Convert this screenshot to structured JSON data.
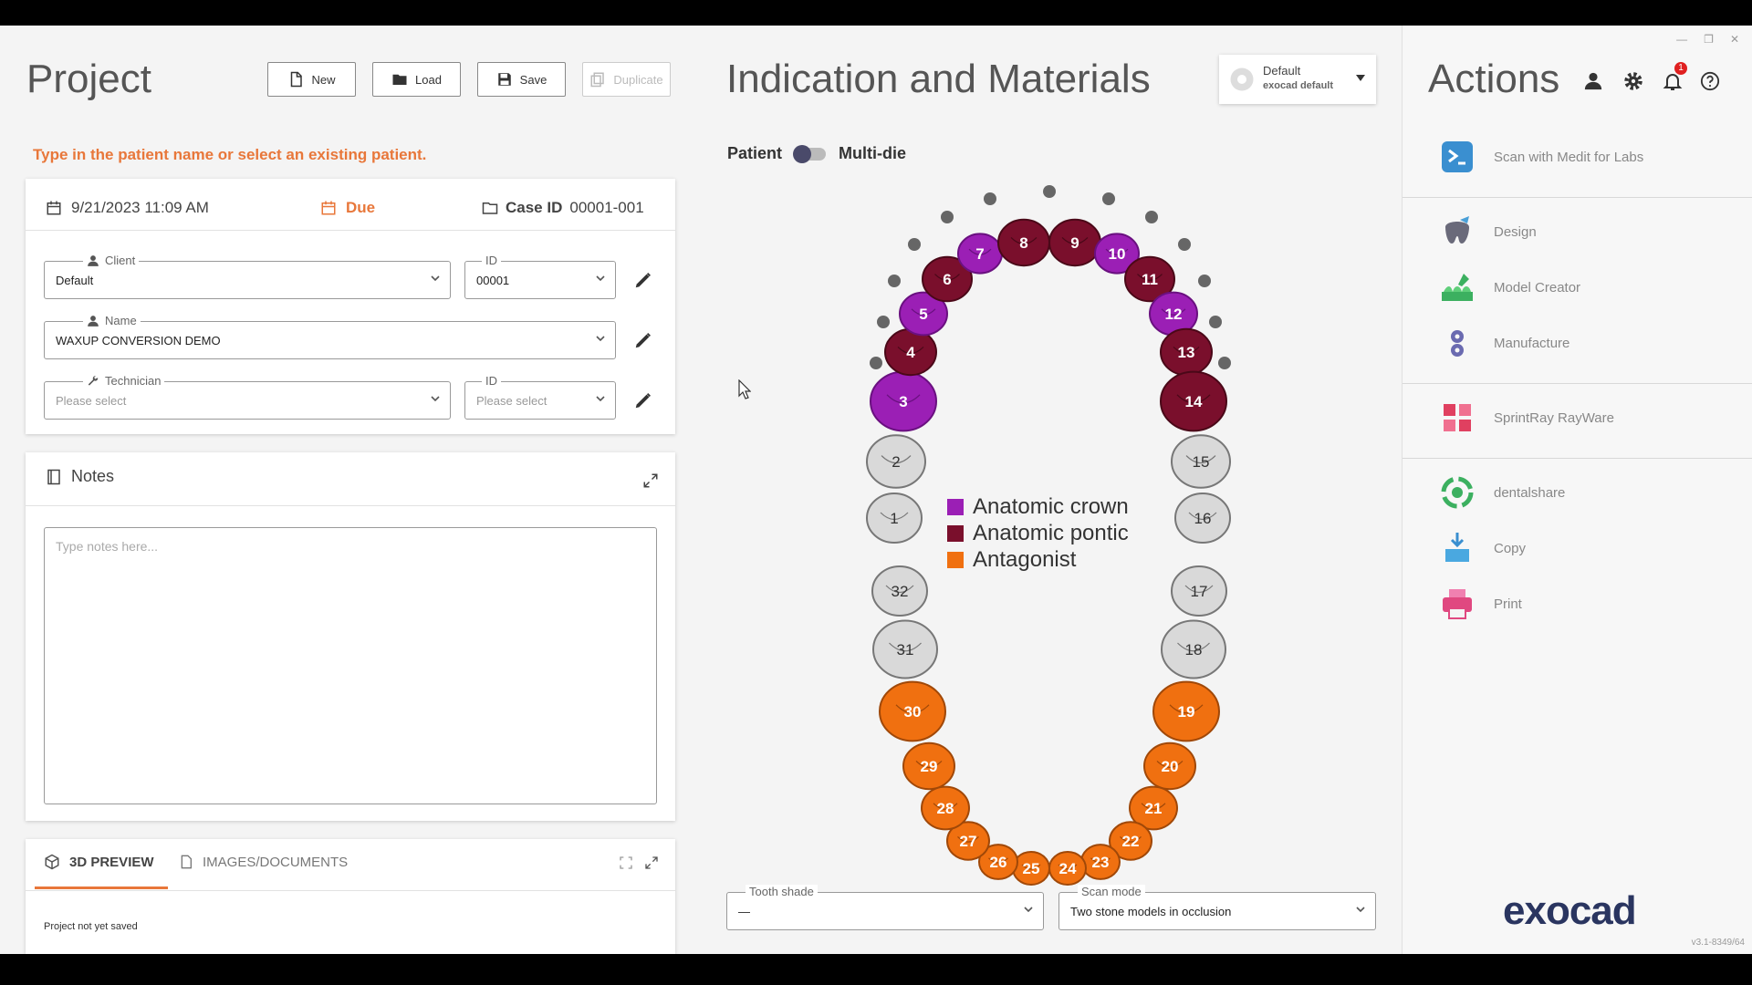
{
  "project": {
    "title": "Project",
    "buttons": {
      "new": "New",
      "load": "Load",
      "save": "Save",
      "duplicate": "Duplicate"
    },
    "hint": "Type in the patient name or select an existing patient.",
    "date": "9/21/2023 11:09 AM",
    "due": "Due",
    "case_id_label": "Case ID",
    "case_id": "00001-001",
    "client": {
      "label": "Client",
      "value": "Default",
      "id_label": "ID",
      "id_value": "00001"
    },
    "name": {
      "label": "Name",
      "value": "WAXUP CONVERSION DEMO"
    },
    "technician": {
      "label": "Technician",
      "placeholder": "Please select",
      "id_label": "ID",
      "id_placeholder": "Please select"
    },
    "notes": {
      "title": "Notes",
      "placeholder": "Type notes here..."
    },
    "tabs": {
      "preview": "3D PREVIEW",
      "images": "IMAGES/DOCUMENTS"
    },
    "status": "Project not yet saved"
  },
  "indication": {
    "title": "Indication and Materials",
    "profile": {
      "name": "Default",
      "sub": "exocad default"
    },
    "toggle": {
      "left": "Patient",
      "right": "Multi-die"
    },
    "legend": [
      {
        "label": "Anatomic crown",
        "color": "#9b1fb5"
      },
      {
        "label": "Anatomic pontic",
        "color": "#7a0f2c"
      },
      {
        "label": "Antagonist",
        "color": "#f07010"
      }
    ],
    "teeth_labels": {
      "t1": "1",
      "t2": "2",
      "t3": "3",
      "t4": "4",
      "t5": "5",
      "t6": "6",
      "t7": "7",
      "t8": "8",
      "t9": "9",
      "t10": "10",
      "t11": "11",
      "t12": "12",
      "t13": "13",
      "t14": "14",
      "t15": "15",
      "t16": "16",
      "t17": "17",
      "t18": "18",
      "t19": "19",
      "t20": "20",
      "t21": "21",
      "t22": "22",
      "t23": "23",
      "t24": "24",
      "t25": "25",
      "t26": "26",
      "t27": "27",
      "t28": "28",
      "t29": "29",
      "t30": "30",
      "t31": "31",
      "t32": "32"
    },
    "tooth_shade": {
      "label": "Tooth shade",
      "value": "—"
    },
    "scan_mode": {
      "label": "Scan mode",
      "value": "Two stone models in occlusion"
    }
  },
  "actions": {
    "title": "Actions",
    "notification_count": "1",
    "items": [
      {
        "label": "Scan with Medit for Labs",
        "icon": "scan-icon"
      },
      {
        "label": "Design",
        "icon": "design-tooth-icon"
      },
      {
        "label": "Model Creator",
        "icon": "model-creator-icon"
      },
      {
        "label": "Manufacture",
        "icon": "manufacture-gear-icon"
      },
      {
        "label": "SprintRay RayWare",
        "icon": "sprintray-icon"
      },
      {
        "label": "dentalshare",
        "icon": "dentalshare-icon"
      },
      {
        "label": "Copy",
        "icon": "copy-icon"
      },
      {
        "label": "Print",
        "icon": "print-icon"
      }
    ],
    "brand": "exocad",
    "version": "v3.1-8349/64"
  },
  "colors": {
    "crown": "#9b1fb5",
    "pontic": "#7a0f2c",
    "antagonist": "#f07010",
    "accent": "#e8773a"
  }
}
